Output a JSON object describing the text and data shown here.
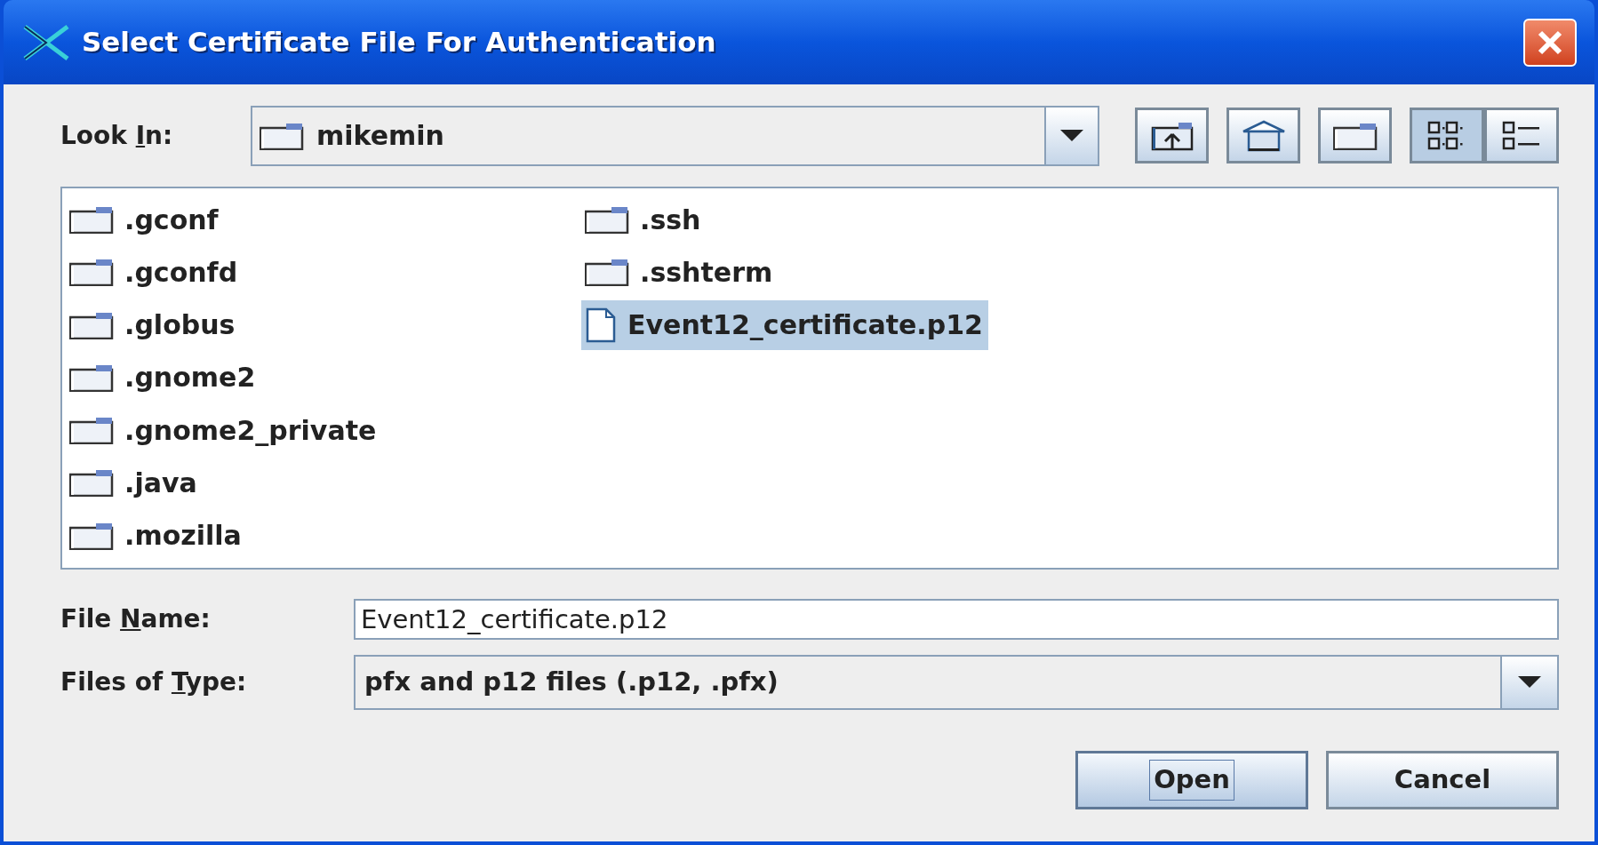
{
  "window": {
    "title": "Select Certificate File For Authentication"
  },
  "look_in": {
    "label": {
      "before": "Look ",
      "key": "I",
      "after": "n:"
    },
    "value": "mikemin"
  },
  "view_buttons": [
    {
      "kind": "list",
      "selected": true
    },
    {
      "kind": "details",
      "selected": false
    }
  ],
  "files": [
    {
      "name": ".gconf",
      "kind": "folder",
      "selected": false
    },
    {
      "name": ".gconfd",
      "kind": "folder",
      "selected": false
    },
    {
      "name": ".globus",
      "kind": "folder",
      "selected": false
    },
    {
      "name": ".gnome2",
      "kind": "folder",
      "selected": false
    },
    {
      "name": ".gnome2_private",
      "kind": "folder",
      "selected": false
    },
    {
      "name": ".java",
      "kind": "folder",
      "selected": false
    },
    {
      "name": ".mozilla",
      "kind": "folder",
      "selected": false
    },
    {
      "name": ".ssh",
      "kind": "folder",
      "selected": false
    },
    {
      "name": ".sshterm",
      "kind": "folder",
      "selected": false
    },
    {
      "name": "Event12_certificate.p12",
      "kind": "file",
      "selected": true
    }
  ],
  "file_name": {
    "label": {
      "before": "File ",
      "key": "N",
      "after": "ame:"
    },
    "value": "Event12_certificate.p12"
  },
  "file_type": {
    "label": {
      "before": "Files of ",
      "key": "T",
      "after": "ype:"
    },
    "value": "pfx and p12 files (.p12, .pfx)"
  },
  "buttons": [
    {
      "label": "Open",
      "focused": true
    },
    {
      "label": "Cancel",
      "focused": false
    }
  ]
}
